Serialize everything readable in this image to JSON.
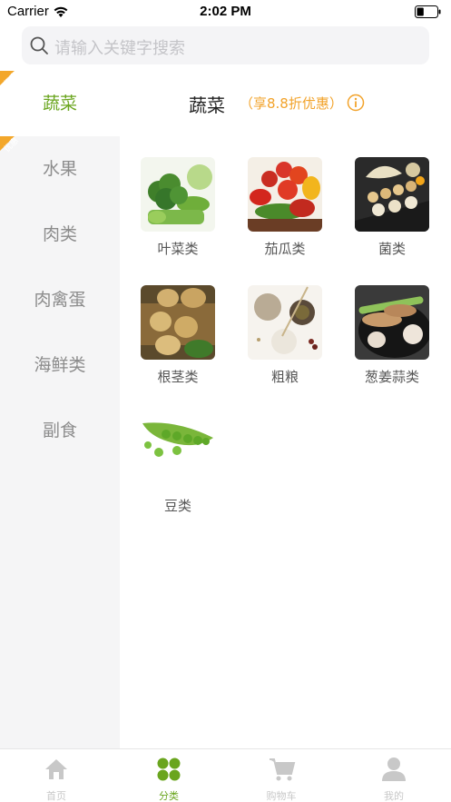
{
  "status_bar": {
    "carrier": "Carrier",
    "time": "2:02 PM",
    "battery_level": 0.35
  },
  "search": {
    "placeholder": "请输入关键字搜索"
  },
  "sidebar": {
    "promo_tag": "优惠",
    "items": [
      {
        "label": "蔬菜",
        "active": true,
        "promo": true
      },
      {
        "label": "水果",
        "active": false,
        "promo": true
      },
      {
        "label": "肉类",
        "active": false,
        "promo": false
      },
      {
        "label": "肉禽蛋",
        "active": false,
        "promo": false
      },
      {
        "label": "海鲜类",
        "active": false,
        "promo": false
      },
      {
        "label": "副食",
        "active": false,
        "promo": false
      }
    ]
  },
  "category": {
    "title": "蔬菜",
    "discount": "（享8.8折优惠）",
    "items": [
      {
        "label": "叶菜类",
        "image": "broccoli"
      },
      {
        "label": "茄瓜类",
        "image": "tomatoes-peppers"
      },
      {
        "label": "菌类",
        "image": "mushrooms"
      },
      {
        "label": "根茎类",
        "image": "potatoes"
      },
      {
        "label": "粗粮",
        "image": "grains"
      },
      {
        "label": "葱姜蒜类",
        "image": "ginger-garlic"
      },
      {
        "label": "豆类",
        "image": "peas"
      }
    ]
  },
  "tab_bar": {
    "tabs": [
      {
        "label": "首页",
        "icon": "home-icon",
        "active": false
      },
      {
        "label": "分类",
        "icon": "category-icon",
        "active": true
      },
      {
        "label": "购物车",
        "icon": "cart-icon",
        "active": false
      },
      {
        "label": "我的",
        "icon": "profile-icon",
        "active": false
      }
    ]
  },
  "colors": {
    "accent": "#6aa51e",
    "promo": "#f3a72b",
    "discount": "#f2a32b",
    "sidebar_bg": "#f5f5f6",
    "inactive": "#c8c8c8"
  }
}
